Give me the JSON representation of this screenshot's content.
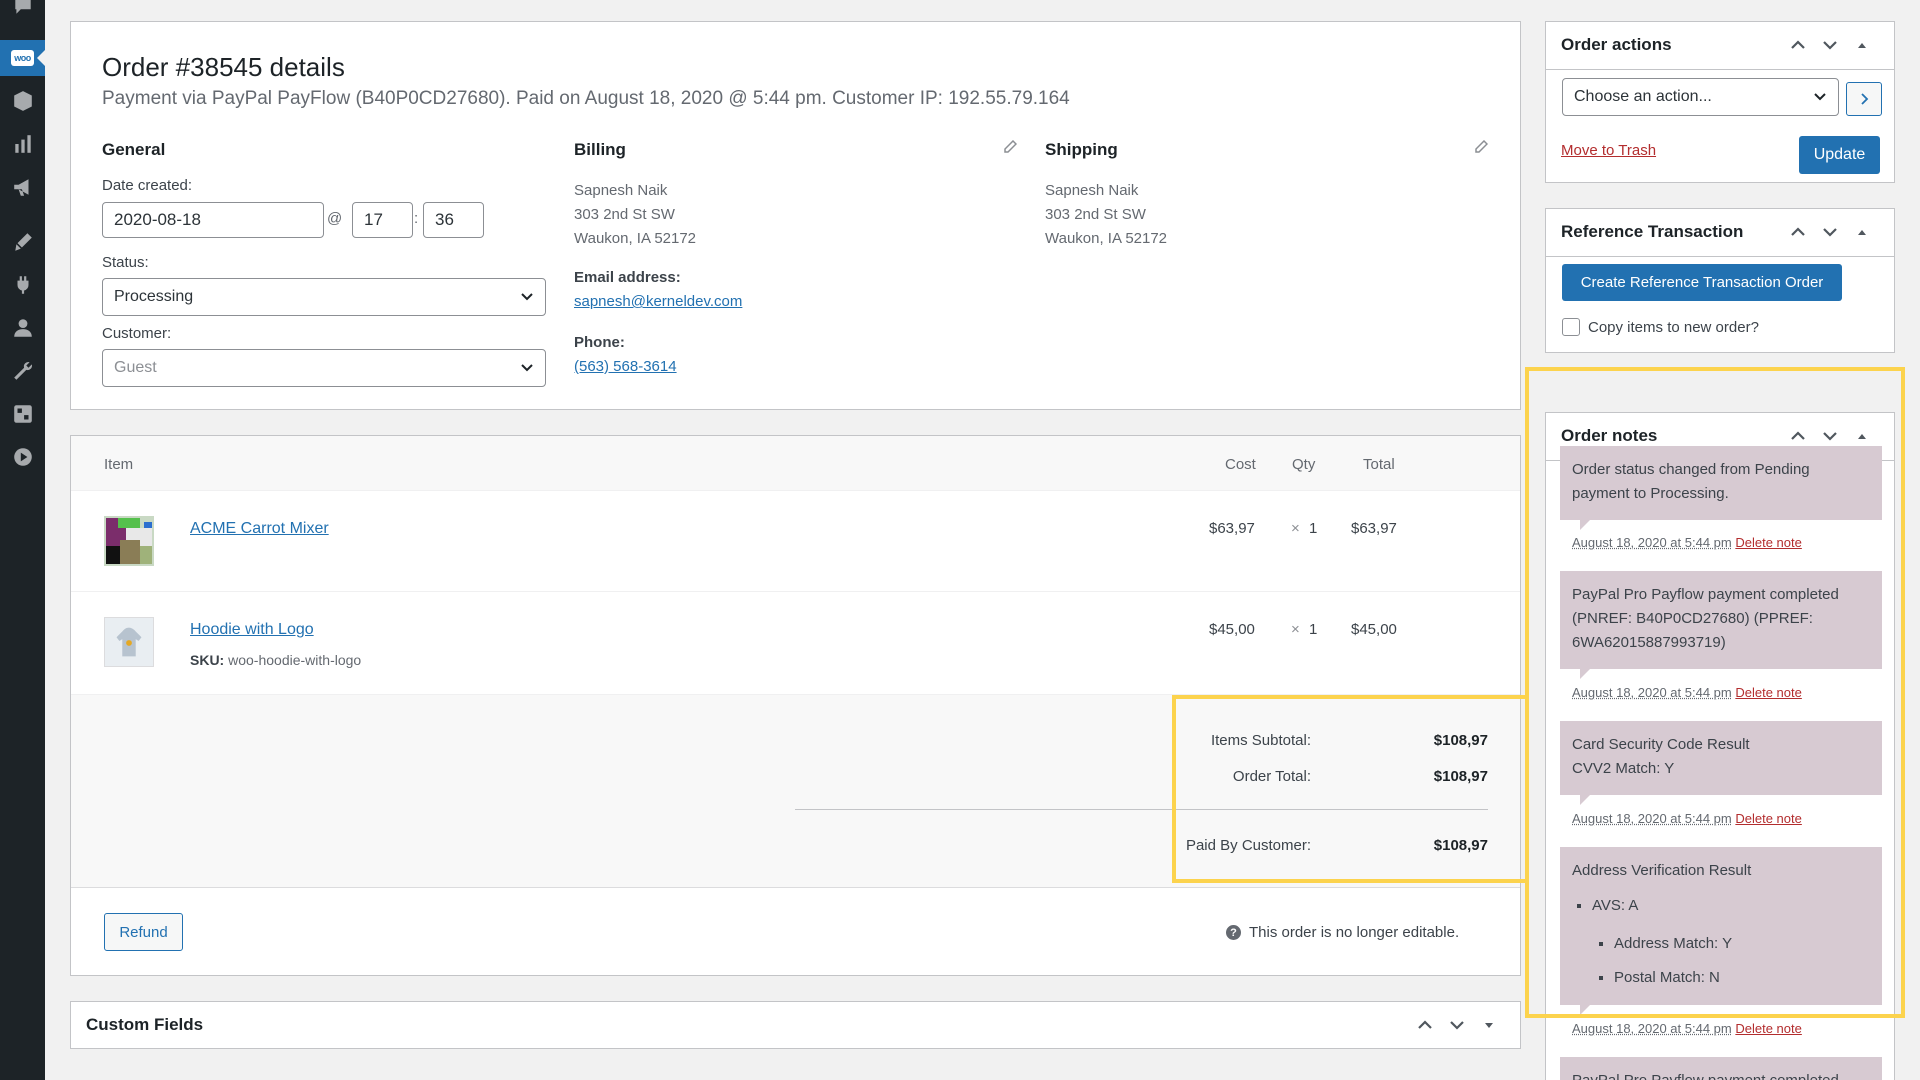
{
  "order": {
    "title": "Order #38545 details",
    "subtitle": "Payment via PayPal PayFlow (B40P0CD27680). Paid on August 18, 2020 @ 5:44 pm. Customer IP: 192.55.79.164"
  },
  "general": {
    "heading": "General",
    "date_label": "Date created:",
    "date_value": "2020-08-18",
    "at": "@",
    "hour": "17",
    "colon": ":",
    "minute": "36",
    "status_label": "Status:",
    "status_value": "Processing",
    "customer_label": "Customer:",
    "customer_value": "Guest"
  },
  "billing": {
    "heading": "Billing",
    "name": "Sapnesh Naik",
    "street": "303 2nd St SW",
    "city": "Waukon, IA 52172",
    "email_label": "Email address:",
    "email": "sapnesh@kerneldev.com",
    "phone_label": "Phone:",
    "phone": "(563) 568-3614"
  },
  "shipping": {
    "heading": "Shipping",
    "name": "Sapnesh Naik",
    "street": "303 2nd St SW",
    "city": "Waukon, IA 52172"
  },
  "items": {
    "headers": {
      "item": "Item",
      "cost": "Cost",
      "qty": "Qty",
      "total": "Total"
    },
    "rows": [
      {
        "name": "ACME Carrot Mixer",
        "cost": "$63,97",
        "qty_x": "×",
        "qty": "1",
        "total": "$63,97"
      },
      {
        "name": "Hoodie with Logo",
        "sku_label": "SKU:",
        "sku": "woo-hoodie-with-logo",
        "cost": "$45,00",
        "qty_x": "×",
        "qty": "1",
        "total": "$45,00"
      }
    ],
    "totals": {
      "subtotal_label": "Items Subtotal:",
      "subtotal": "$108,97",
      "order_total_label": "Order Total:",
      "order_total": "$108,97",
      "paid_label": "Paid By Customer:",
      "paid": "$108,97"
    },
    "refund_label": "Refund",
    "not_editable": "This order is no longer editable.",
    "help_glyph": "?"
  },
  "custom_fields": {
    "title": "Custom Fields"
  },
  "order_actions": {
    "title": "Order actions",
    "select_placeholder": "Choose an action...",
    "trash_label": "Move to Trash",
    "update_label": "Update"
  },
  "reference_transaction": {
    "title": "Reference Transaction",
    "button_label": "Create Reference Transaction Order",
    "checkbox_label": "Copy items to new order?"
  },
  "order_notes": {
    "title": "Order notes",
    "notes": [
      {
        "text": "Order status changed from Pending payment to Processing.",
        "date": "August 18, 2020 at 5:44 pm",
        "delete": "Delete note"
      },
      {
        "text": "PayPal Pro Payflow payment completed (PNREF: B40P0CD27680) (PPREF: 6WA62015887993719)",
        "date": "August 18, 2020 at 5:44 pm",
        "delete": "Delete note"
      },
      {
        "text_line1": "Card Security Code Result",
        "text_line2": "CVV2 Match: Y",
        "date": "August 18, 2020 at 5:44 pm",
        "delete": "Delete note"
      },
      {
        "text": "Address Verification Result",
        "avs": "AVS: A",
        "address_match": "Address Match: Y",
        "postal_match": "Postal Match: N",
        "date": "August 18, 2020 at 5:44 pm",
        "delete": "Delete note"
      },
      {
        "text": "PayPal Pro Payflow payment completed"
      }
    ]
  },
  "sidebar": {
    "woo_badge": "woo",
    "icons": [
      "comments-icon",
      "woocommerce-icon",
      "products-icon",
      "analytics-icon",
      "marketing-icon",
      "appearance-icon",
      "plugins-icon",
      "users-icon",
      "tools-icon",
      "settings-icon",
      "media-play-icon"
    ]
  },
  "colors": {
    "accent": "#2271b1",
    "highlight": "#fcd34d",
    "note_bg": "#d7cad2",
    "danger": "#b32d2e"
  }
}
